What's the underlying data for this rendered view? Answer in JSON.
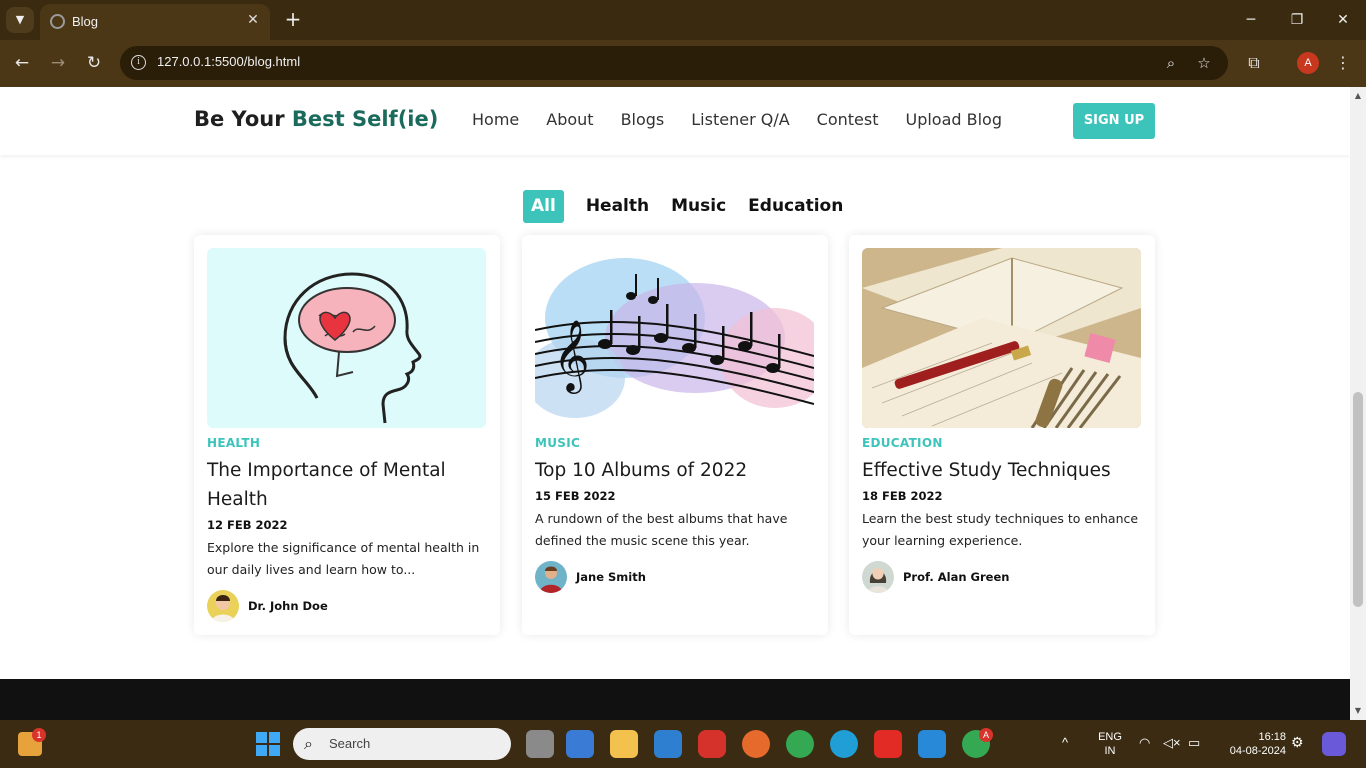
{
  "browser": {
    "tab_title": "Blog",
    "url": "127.0.0.1:5500/blog.html",
    "profile_initial": "A"
  },
  "site": {
    "brand_prefix": "Be Your ",
    "brand_accent": "Best Self(ie)",
    "nav": [
      "Home",
      "About",
      "Blogs",
      "Listener Q/A",
      "Contest",
      "Upload Blog"
    ],
    "signup_label": "SIGN UP",
    "accent_color": "#3cc4bb"
  },
  "filters": {
    "items": [
      "All",
      "Health",
      "Music",
      "Education"
    ],
    "active": "All"
  },
  "posts": [
    {
      "category": "HEALTH",
      "title": "The Importance of Mental Health",
      "date": "12 FEB 2022",
      "excerpt": "Explore the significance of mental health in our daily lives and learn how to...",
      "author": "Dr. John Doe"
    },
    {
      "category": "MUSIC",
      "title": "Top 10 Albums of 2022",
      "date": "15 FEB 2022",
      "excerpt": "A rundown of the best albums that have defined the music scene this year.",
      "author": "Jane Smith"
    },
    {
      "category": "EDUCATION",
      "title": "Effective Study Techniques",
      "date": "18 FEB 2022",
      "excerpt": "Learn the best study techniques to enhance your learning experience.",
      "author": "Prof. Alan Green"
    }
  ],
  "taskbar": {
    "search_placeholder": "Search",
    "notification_count": "1",
    "chrome_badge": "A",
    "lang_line1": "ENG",
    "lang_line2": "IN",
    "time": "16:18",
    "date": "04-08-2024"
  }
}
